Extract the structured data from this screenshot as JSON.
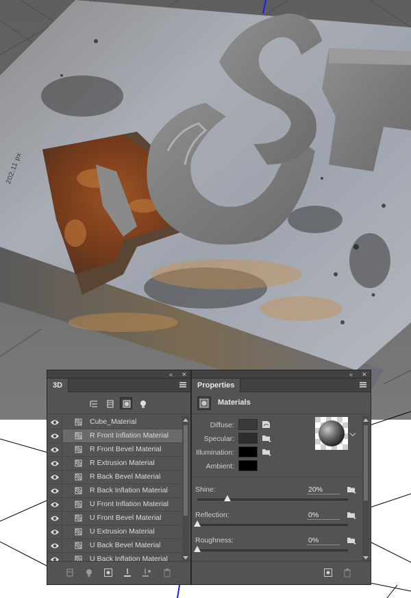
{
  "viewport": {
    "ruler_readout": "202.11 px"
  },
  "panel_3d": {
    "tab": "3D",
    "filters": [
      "scene-filter-icon",
      "mesh-filter-icon",
      "material-filter-icon",
      "light-filter-icon"
    ],
    "active_filter": "material-filter-icon",
    "items": [
      {
        "label": "Cube_Material",
        "visible": true,
        "selected": false
      },
      {
        "label": "R Front Inflation Material",
        "visible": true,
        "selected": true
      },
      {
        "label": "R Front Bevel Material",
        "visible": true,
        "selected": false
      },
      {
        "label": "R Extrusion Material",
        "visible": true,
        "selected": false
      },
      {
        "label": "R Back Bevel Material",
        "visible": true,
        "selected": false
      },
      {
        "label": "R Back Inflation Material",
        "visible": true,
        "selected": false
      },
      {
        "label": "U Front Inflation Material",
        "visible": true,
        "selected": false
      },
      {
        "label": "U Front Bevel Material",
        "visible": true,
        "selected": false
      },
      {
        "label": "U Extrusion Material",
        "visible": true,
        "selected": false
      },
      {
        "label": "U Back Bevel Material",
        "visible": true,
        "selected": false
      },
      {
        "label": "U Back Inflation Material",
        "visible": true,
        "selected": false
      }
    ]
  },
  "properties": {
    "tab": "Properties",
    "section": "Materials",
    "colors": [
      {
        "label": "Diffuse:",
        "swatch": "#3a3a3a"
      },
      {
        "label": "Specular:",
        "swatch": "#2e2e2e"
      },
      {
        "label": "Illumination:",
        "swatch": "#000000"
      },
      {
        "label": "Ambient:",
        "swatch": "#000000"
      }
    ],
    "sliders": [
      {
        "label": "Shine:",
        "value": "20%",
        "fraction": 0.2
      },
      {
        "label": "Reflection:",
        "value": "0%",
        "fraction": 0.0
      },
      {
        "label": "Roughness:",
        "value": "0%",
        "fraction": 0.0
      }
    ]
  },
  "colors": {
    "panel_bg": "#535353",
    "panel_dark": "#424242",
    "selected_row": "#6a6a6a",
    "rust": "#8a4a22",
    "text": "#dcdcdc"
  }
}
